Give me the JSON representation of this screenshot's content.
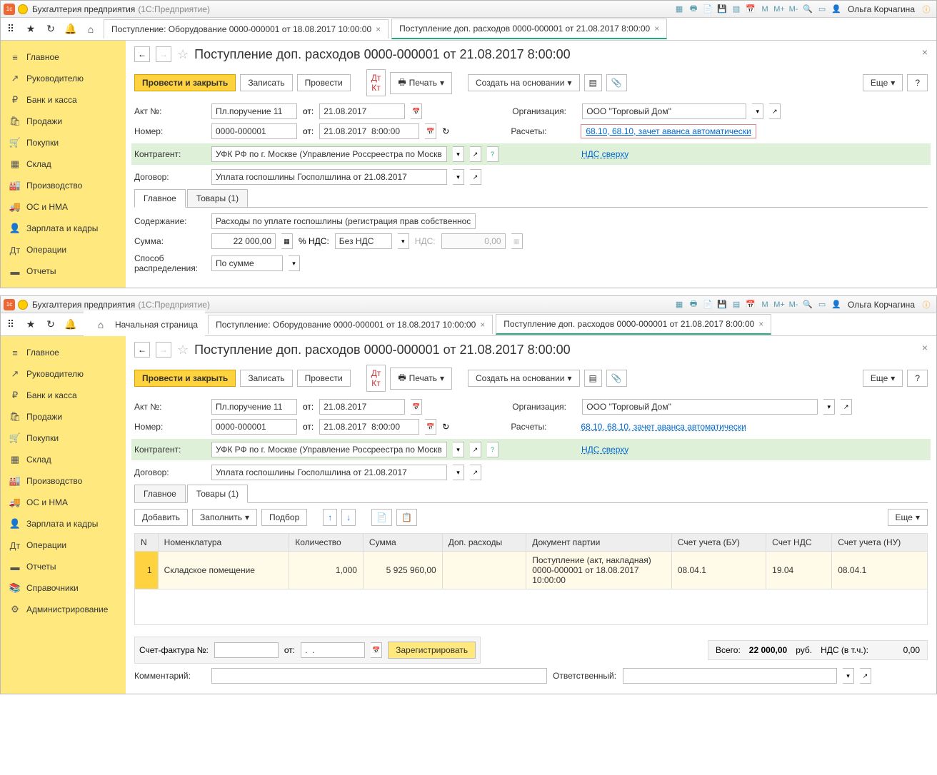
{
  "app": {
    "title": "Бухгалтерия предприятия",
    "subtitle": "(1С:Предприятие)",
    "user": "Ольга Корчагина"
  },
  "tbicons": [
    "M",
    "M+",
    "M-"
  ],
  "sidebar": {
    "items": [
      {
        "label": "Главное",
        "icon": "≡"
      },
      {
        "label": "Руководителю",
        "icon": "↗"
      },
      {
        "label": "Банк и касса",
        "icon": "₽"
      },
      {
        "label": "Продажи",
        "icon": "🛍"
      },
      {
        "label": "Покупки",
        "icon": "🛒"
      },
      {
        "label": "Склад",
        "icon": "▦"
      },
      {
        "label": "Производство",
        "icon": "🏭"
      },
      {
        "label": "ОС и НМА",
        "icon": "🚚"
      },
      {
        "label": "Зарплата и кадры",
        "icon": "👤"
      },
      {
        "label": "Операции",
        "icon": "Дт"
      },
      {
        "label": "Отчеты",
        "icon": "▬"
      },
      {
        "label": "Справочники",
        "icon": "📚"
      },
      {
        "label": "Администрирование",
        "icon": "⚙"
      }
    ]
  },
  "tabs": {
    "w1": [
      {
        "label": "Поступление: Оборудование 0000-000001 от 18.08.2017 10:00:00",
        "active": false
      },
      {
        "label": "Поступление доп. расходов 0000-000001 от 21.08.2017 8:00:00",
        "active": true
      }
    ],
    "w2_home": "Начальная страница",
    "w2": [
      {
        "label": "Поступление: Оборудование 0000-000001 от 18.08.2017 10:00:00",
        "active": false
      },
      {
        "label": "Поступление доп. расходов 0000-000001 от 21.08.2017 8:00:00",
        "active": true
      }
    ]
  },
  "page": {
    "title": "Поступление доп. расходов 0000-000001 от 21.08.2017 8:00:00",
    "toolbar": {
      "post_close": "Провести и закрыть",
      "save": "Записать",
      "post": "Провести",
      "print": "Печать",
      "create_based": "Создать на основании",
      "more": "Еще",
      "help": "?"
    },
    "form": {
      "act_label": "Акт №:",
      "act_val": "Пл.поручение 11",
      "ot": "от:",
      "act_date": "21.08.2017",
      "org_label": "Организация:",
      "org_val": "ООО \"Торговый Дом\"",
      "num_label": "Номер:",
      "num_val": "0000-000001",
      "num_date": "21.08.2017  8:00:00",
      "calc_label": "Расчеты:",
      "calc_link": "68.10, 68.10, зачет аванса автоматически",
      "vat_link": "НДС сверху",
      "contr_label": "Контрагент:",
      "contr_val": "УФК РФ по г. Москве (Управление Россреестра по Москв",
      "dogovor_label": "Договор:",
      "dogovor_val": "Уплата госпошлины Госполшлина от 21.08.2017",
      "tab_main": "Главное",
      "tab_goods": "Товары (1)",
      "content_label": "Содержание:",
      "content_val": "Расходы по уплате госпошлины (регистрация прав собственнос",
      "sum_label": "Сумма:",
      "sum_val": "22 000,00",
      "vat_pct_label": "% НДС:",
      "vat_pct_val": "Без НДС",
      "nds_label": "НДС:",
      "nds_val": "0,00",
      "method_label": "Способ распределения:",
      "method_val": "По сумме"
    },
    "goods_toolbar": {
      "add": "Добавить",
      "fill": "Заполнить",
      "select": "Подбор",
      "more": "Еще"
    },
    "goods_table": {
      "headers": [
        "N",
        "Номенклатура",
        "Количество",
        "Сумма",
        "Доп. расходы",
        "Документ партии",
        "Счет учета (БУ)",
        "Счет НДС",
        "Счет учета (НУ)"
      ],
      "rows": [
        {
          "n": "1",
          "nomen": "Складское помещение",
          "qty": "1,000",
          "sum": "5 925 960,00",
          "extra": "",
          "doc": "Поступление (акт, накладная) 0000-000001 от 18.08.2017 10:00:00",
          "bu": "08.04.1",
          "nds": "19.04",
          "nu": "08.04.1"
        }
      ]
    },
    "invoice": {
      "label": "Счет-фактура №:",
      "ot": "от:",
      "date": ".  .",
      "register": "Зарегистрировать"
    },
    "totals": {
      "total_label": "Всего:",
      "total": "22 000,00",
      "rub": "руб.",
      "nds_label": "НДС (в т.ч.):",
      "nds": "0,00"
    },
    "comment_label": "Комментарий:",
    "resp_label": "Ответственный:"
  }
}
